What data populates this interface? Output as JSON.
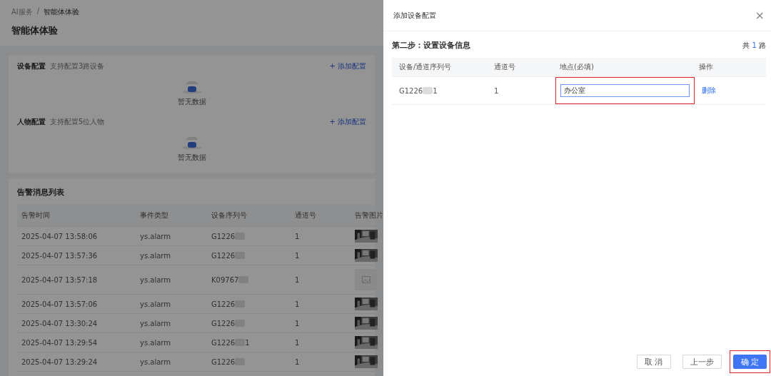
{
  "breadcrumb": [
    "AI服务",
    "/",
    "智能体体验"
  ],
  "page_title": "智能体体验",
  "config_sections": [
    {
      "title": "设备配置",
      "hint": "支持配置3路设备",
      "add_link": "+ 添加配置",
      "empty_text": "暂无数据"
    },
    {
      "title": "人物配置",
      "hint": "支持配置5位人物",
      "add_link": "+ 添加配置",
      "empty_text": "暂无数据"
    }
  ],
  "alarm_list": {
    "title": "告警消息列表",
    "columns": [
      "告警时间",
      "事件类型",
      "设备序列号",
      "通道号",
      "告警图片"
    ],
    "rows": [
      {
        "time": "2025-04-07 13:58:06",
        "event": "ys.alarm",
        "serial": "G1226",
        "serial_end": "",
        "channel": "1",
        "kind": "picture"
      },
      {
        "time": "2025-04-07 13:57:36",
        "event": "ys.alarm",
        "serial": "G1226",
        "serial_end": "",
        "channel": "1",
        "kind": "picture"
      },
      {
        "time": "2025-04-07 13:57:18",
        "event": "ys.alarm",
        "serial": "K09767",
        "serial_end": "",
        "channel": "1",
        "kind": "placeholder"
      },
      {
        "time": "2025-04-07 13:57:06",
        "event": "ys.alarm",
        "serial": "G1226",
        "serial_end": "",
        "channel": "1",
        "kind": "picture"
      },
      {
        "time": "2025-04-07 13:30:24",
        "event": "ys.alarm",
        "serial": "G1226",
        "serial_end": "",
        "channel": "1",
        "kind": "picture"
      },
      {
        "time": "2025-04-07 13:29:54",
        "event": "ys.alarm",
        "serial": "G1226",
        "serial_end": "1",
        "channel": "1",
        "kind": "picture"
      },
      {
        "time": "2025-04-07 13:29:24",
        "event": "ys.alarm",
        "serial": "G1226",
        "serial_end": "",
        "channel": "1",
        "kind": "picture"
      }
    ]
  },
  "drawer": {
    "title": "添加设备配置",
    "close": "×",
    "step_title": "第二步：设置设备信息",
    "total_prefix": "共",
    "total_count": "1",
    "total_suffix": "路",
    "columns": [
      "设备/通道序列号",
      "通道号",
      "地点(必填)",
      "操作"
    ],
    "rows": [
      {
        "serial": "G1226",
        "serial_end": "1",
        "channel": "1",
        "location": "办公室",
        "location_highlighted": true,
        "action": "删除"
      }
    ],
    "buttons": [
      {
        "label": "取 消",
        "kind": "default",
        "highlighted": false
      },
      {
        "label": "上一步",
        "kind": "default",
        "highlighted": false
      },
      {
        "label": "确 定",
        "kind": "primary",
        "highlighted": true
      }
    ]
  }
}
